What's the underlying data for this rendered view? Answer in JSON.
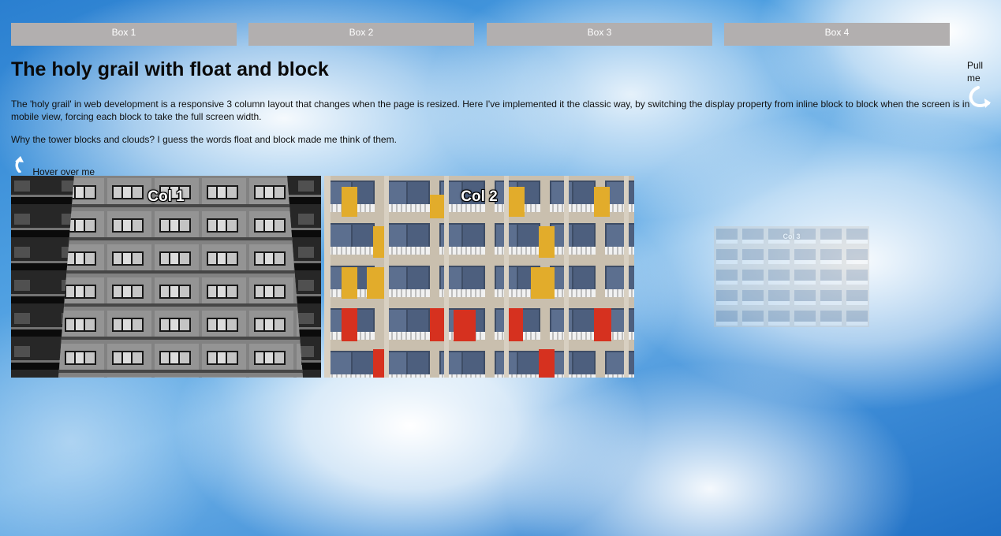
{
  "boxes": [
    {
      "label": "Box 1"
    },
    {
      "label": "Box 2"
    },
    {
      "label": "Box 3"
    },
    {
      "label": "Box 4"
    }
  ],
  "heading": "The holy grail with float and block",
  "paragraphs": [
    "The 'holy grail' in web development is a responsive 3 column layout that changes when the page is resized. Here I've implemented it the classic way, by switching the display property from inline block to block when the screen is in mobile view, forcing each block to take the full screen width.",
    "Why the tower blocks and clouds? I guess the words float and block made me think of them."
  ],
  "pull_hint": {
    "label": "Pull me",
    "icon": "curved-arrow-icon"
  },
  "hover_hint": {
    "label": "Hover over me",
    "icon": "curved-arrow-icon"
  },
  "columns": [
    {
      "title": "Col 1",
      "image": "grey-tower-block"
    },
    {
      "title": "Col 2",
      "image": "colorful-tower-block"
    },
    {
      "title": "Col 3",
      "image": "faded-tower-block"
    }
  ],
  "colors": {
    "box_bg": "#b2afaf",
    "box_text": "#ffffff",
    "sky": "#3c8bd6",
    "panel_yellow": "#e2ac2b",
    "panel_red": "#d6311f"
  }
}
